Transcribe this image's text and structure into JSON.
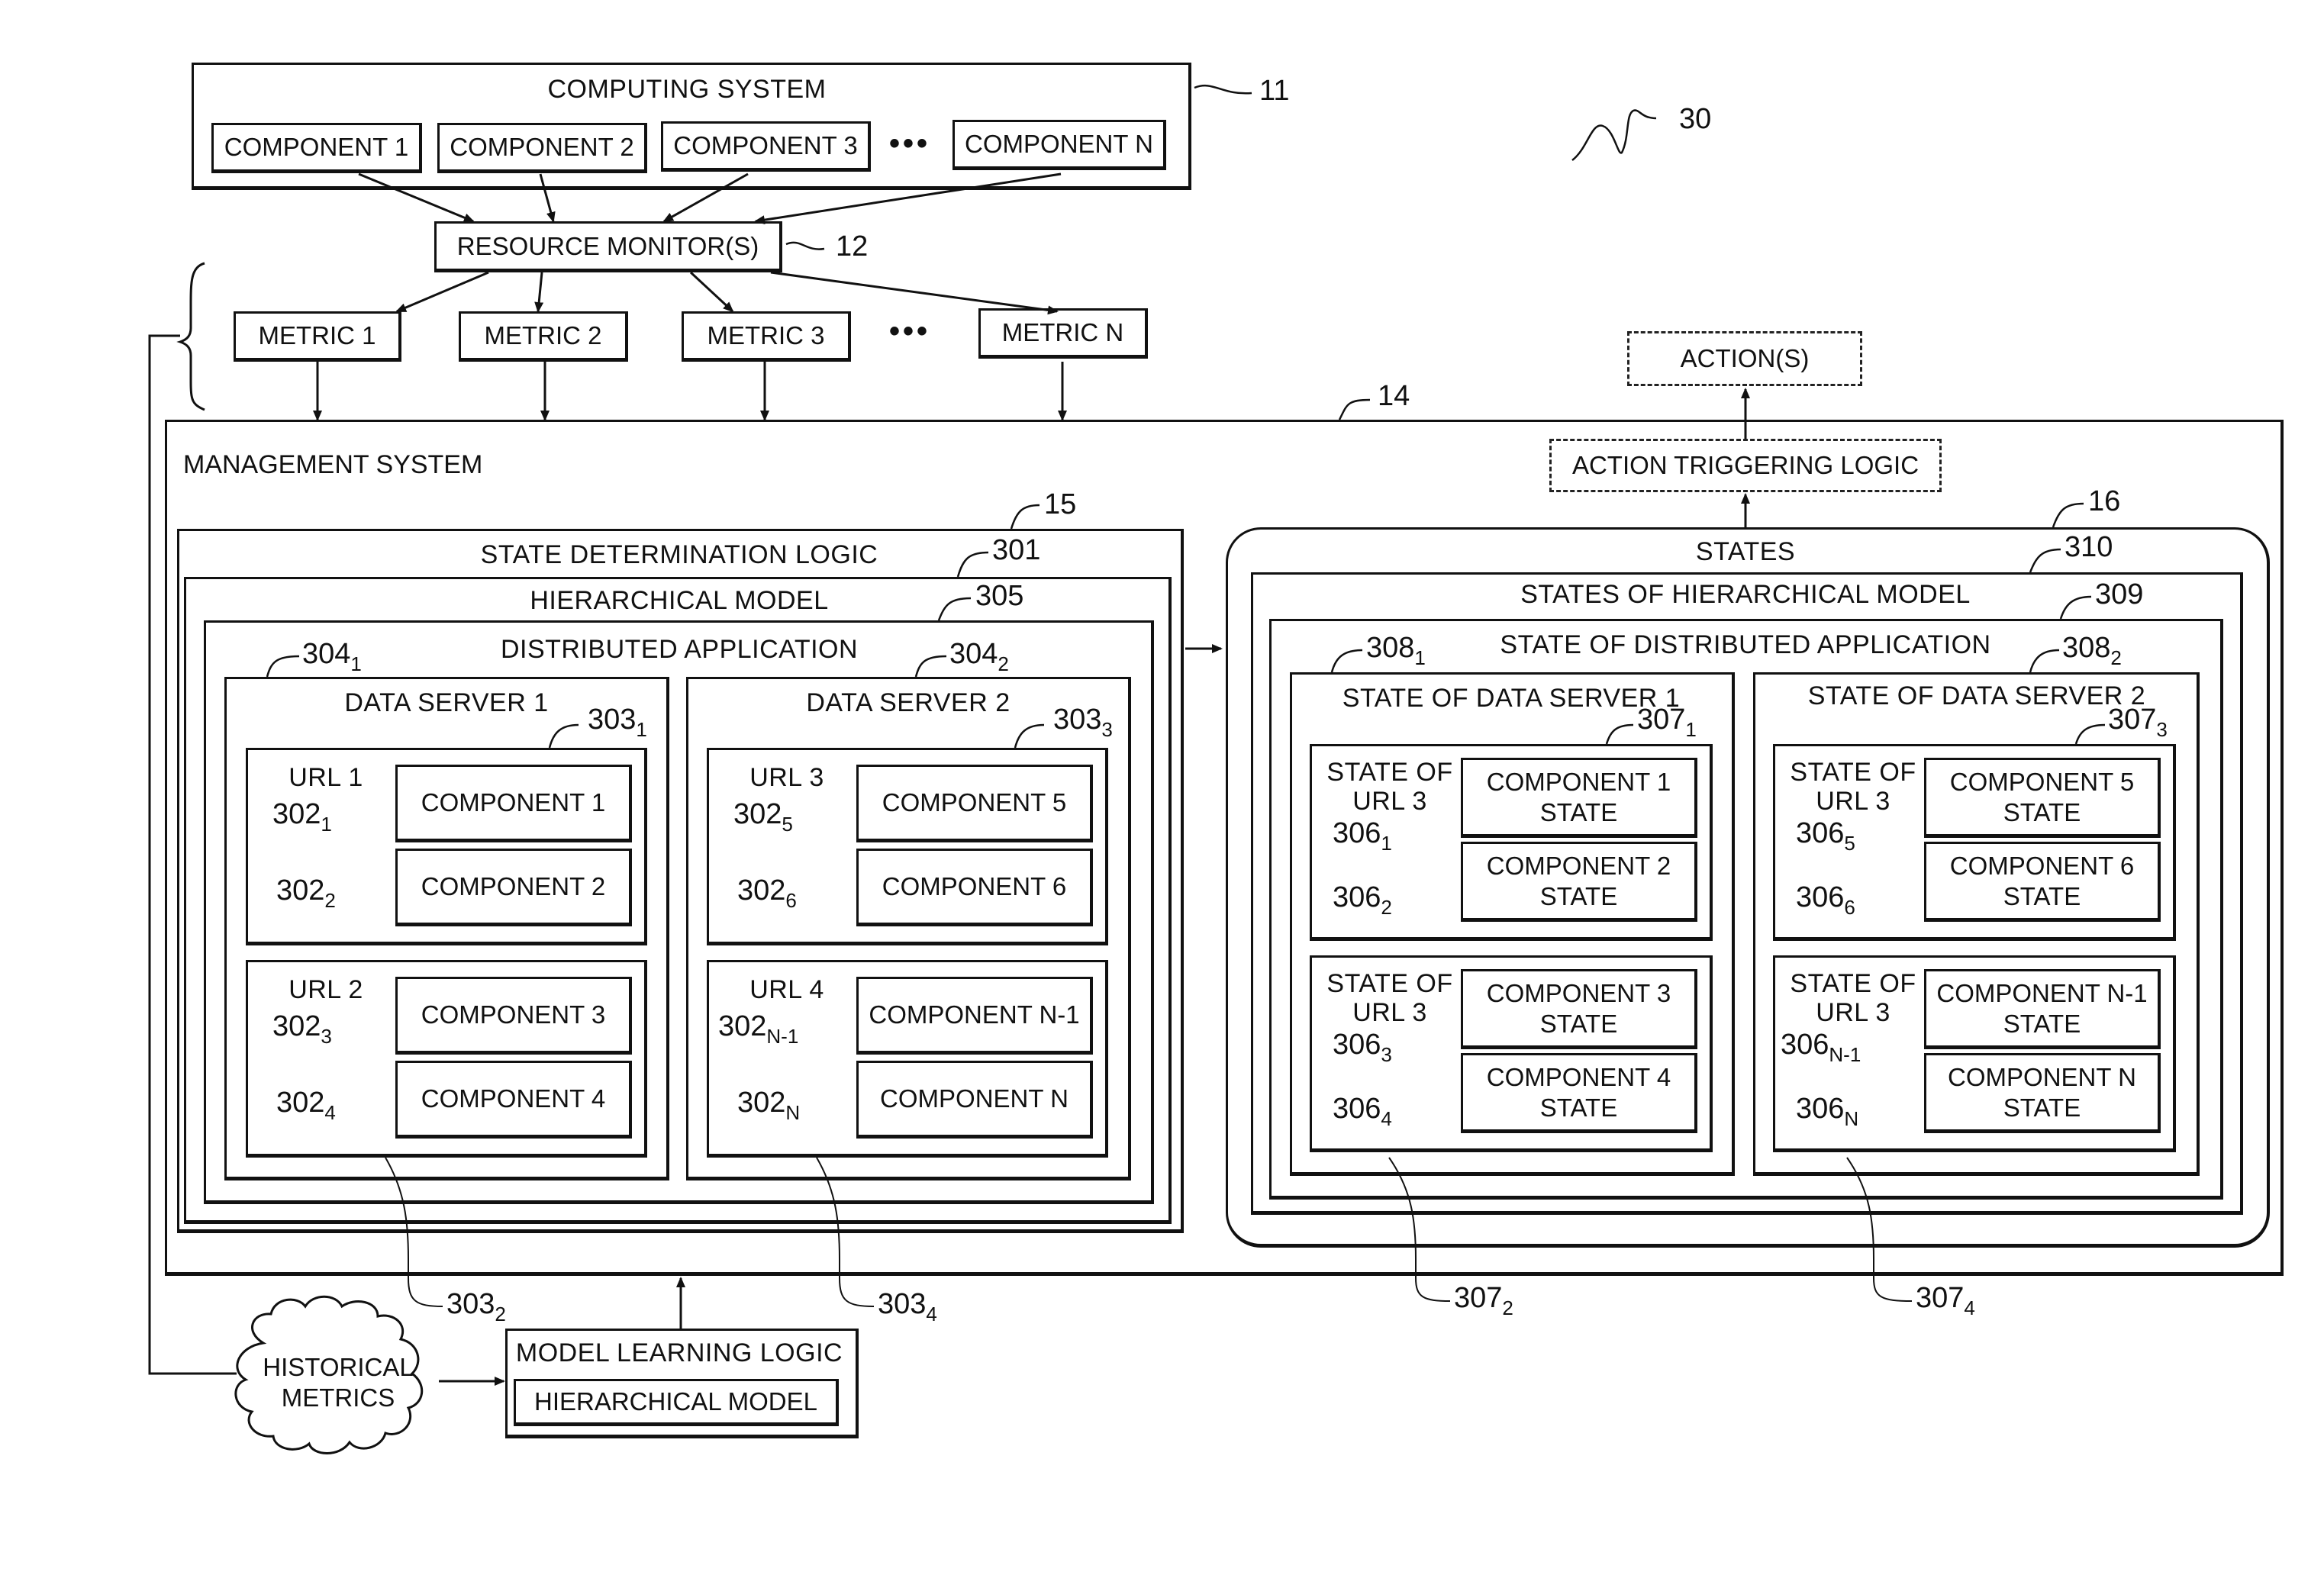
{
  "figure_ref": "30",
  "computing_system": {
    "title": "COMPUTING SYSTEM",
    "ref": "11",
    "components": [
      "COMPONENT 1",
      "COMPONENT 2",
      "COMPONENT 3",
      "COMPONENT N"
    ],
    "ellipsis": "•••"
  },
  "resource_monitor": {
    "label": "RESOURCE MONITOR(S)",
    "ref": "12"
  },
  "metrics": {
    "items": [
      "METRIC 1",
      "METRIC 2",
      "METRIC 3",
      "METRIC N"
    ],
    "ellipsis": "•••"
  },
  "actions": {
    "label": "ACTION(S)"
  },
  "action_triggering_logic": {
    "label": "ACTION TRIGGERING LOGIC"
  },
  "management_system": {
    "label": "MANAGEMENT SYSTEM",
    "ref": "14"
  },
  "state_determination_logic": {
    "label": "STATE DETERMINATION LOGIC",
    "ref": "15",
    "hierarchical_model": {
      "label": "HIERARCHICAL MODEL",
      "ref": "301",
      "distributed_application": {
        "label": "DISTRIBUTED APPLICATION",
        "ref": "305",
        "servers": [
          {
            "label": "DATA SERVER 1",
            "ref": "304",
            "ref_sub": "1",
            "urls": [
              {
                "label": "URL 1",
                "ref": "303",
                "ref_sub": "1",
                "components": [
                  {
                    "label": "COMPONENT 1",
                    "ref": "302",
                    "ref_sub": "1"
                  },
                  {
                    "label": "COMPONENT 2",
                    "ref": "302",
                    "ref_sub": "2"
                  }
                ]
              },
              {
                "label": "URL 2",
                "ref": "303",
                "ref_sub": "2",
                "components": [
                  {
                    "label": "COMPONENT 3",
                    "ref": "302",
                    "ref_sub": "3"
                  },
                  {
                    "label": "COMPONENT 4",
                    "ref": "302",
                    "ref_sub": "4"
                  }
                ]
              }
            ]
          },
          {
            "label": "DATA SERVER 2",
            "ref": "304",
            "ref_sub": "2",
            "urls": [
              {
                "label": "URL 3",
                "ref": "303",
                "ref_sub": "3",
                "components": [
                  {
                    "label": "COMPONENT 5",
                    "ref": "302",
                    "ref_sub": "5"
                  },
                  {
                    "label": "COMPONENT 6",
                    "ref": "302",
                    "ref_sub": "6"
                  }
                ]
              },
              {
                "label": "URL 4",
                "ref": "303",
                "ref_sub": "4",
                "components": [
                  {
                    "label": "COMPONENT N-1",
                    "ref": "302",
                    "ref_sub": "N-1"
                  },
                  {
                    "label": "COMPONENT N",
                    "ref": "302",
                    "ref_sub": "N"
                  }
                ]
              }
            ]
          }
        ]
      }
    }
  },
  "states": {
    "label": "STATES",
    "ref": "16",
    "states_of_hierarchical_model": {
      "label": "STATES OF HIERARCHICAL MODEL",
      "ref": "310",
      "state_of_distributed_application": {
        "label": "STATE OF DISTRIBUTED APPLICATION",
        "ref": "309",
        "servers": [
          {
            "label": "STATE OF DATA SERVER 1",
            "ref": "308",
            "ref_sub": "1",
            "urls": [
              {
                "label_line1": "STATE OF",
                "label_line2": "URL 3",
                "ref": "307",
                "ref_sub": "1",
                "components": [
                  {
                    "line1": "COMPONENT 1",
                    "line2": "STATE",
                    "ref": "306",
                    "ref_sub": "1"
                  },
                  {
                    "line1": "COMPONENT 2",
                    "line2": "STATE",
                    "ref": "306",
                    "ref_sub": "2"
                  }
                ]
              },
              {
                "label_line1": "STATE OF",
                "label_line2": "URL 3",
                "ref": "307",
                "ref_sub": "2",
                "components": [
                  {
                    "line1": "COMPONENT 3",
                    "line2": "STATE",
                    "ref": "306",
                    "ref_sub": "3"
                  },
                  {
                    "line1": "COMPONENT 4",
                    "line2": "STATE",
                    "ref": "306",
                    "ref_sub": "4"
                  }
                ]
              }
            ]
          },
          {
            "label": "STATE OF DATA SERVER 2",
            "ref": "308",
            "ref_sub": "2",
            "urls": [
              {
                "label_line1": "STATE OF",
                "label_line2": "URL 3",
                "ref": "307",
                "ref_sub": "3",
                "components": [
                  {
                    "line1": "COMPONENT 5",
                    "line2": "STATE",
                    "ref": "306",
                    "ref_sub": "5"
                  },
                  {
                    "line1": "COMPONENT 6",
                    "line2": "STATE",
                    "ref": "306",
                    "ref_sub": "6"
                  }
                ]
              },
              {
                "label_line1": "STATE OF",
                "label_line2": "URL 3",
                "ref": "307",
                "ref_sub": "4",
                "components": [
                  {
                    "line1": "COMPONENT N-1",
                    "line2": "STATE",
                    "ref": "306",
                    "ref_sub": "N-1"
                  },
                  {
                    "line1": "COMPONENT N",
                    "line2": "STATE",
                    "ref": "306",
                    "ref_sub": "N"
                  }
                ]
              }
            ]
          }
        ]
      }
    }
  },
  "historical_metrics": {
    "line1": "HISTORICAL",
    "line2": "METRICS"
  },
  "model_learning_logic": {
    "label": "MODEL LEARNING LOGIC",
    "inner": "HIERARCHICAL MODEL"
  }
}
